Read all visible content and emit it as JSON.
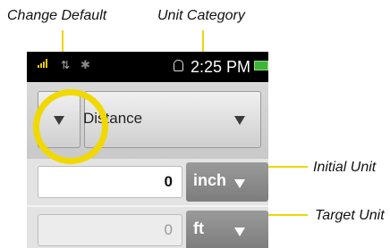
{
  "callouts": {
    "change_default": "Change Default",
    "unit_category": "Unit Category",
    "initial_unit": "Initial Unit",
    "target_unit": "Target Unit"
  },
  "status_bar": {
    "time": "2:25 PM",
    "icons": [
      "signal-icon",
      "data-icon",
      "bluetooth-off-icon",
      "alarm-icon",
      "battery-icon"
    ]
  },
  "category": {
    "value": "Distance",
    "dropdown_icon": "triangle-down-icon",
    "change_default_icon": "triangle-down-icon"
  },
  "initial": {
    "value": "0",
    "unit": "inch"
  },
  "target": {
    "value": "0",
    "unit": "ft"
  },
  "colors": {
    "highlight": "#f0d800",
    "status_bar": "#000000",
    "unit_button": "#8a8a8a"
  }
}
